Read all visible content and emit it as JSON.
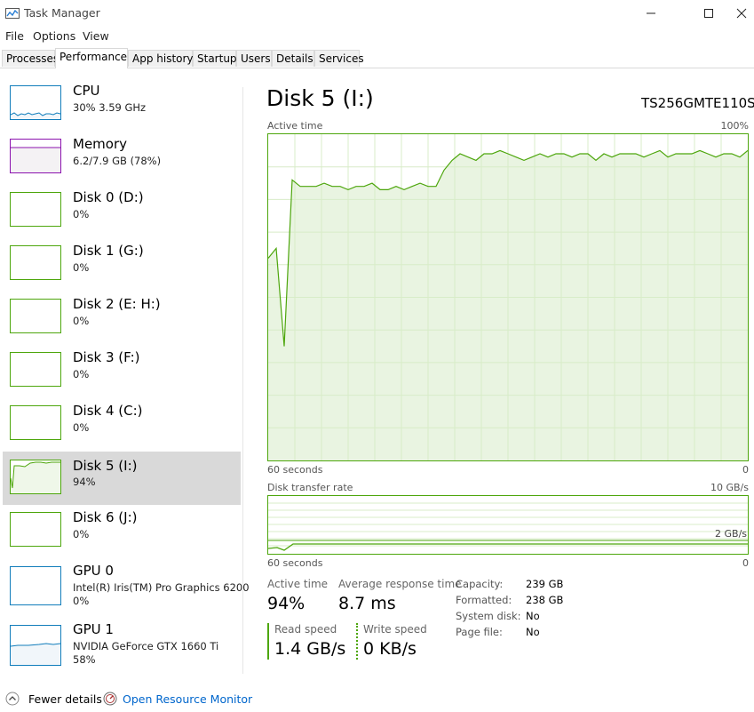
{
  "window": {
    "title": "Task Manager",
    "icon": "task-manager-icon",
    "minimize": "—",
    "maximize": "☐",
    "close": "✕"
  },
  "menu": {
    "file": "File",
    "options": "Options",
    "view": "View"
  },
  "tabs": [
    "Processes",
    "Performance",
    "App history",
    "Startup",
    "Users",
    "Details",
    "Services"
  ],
  "active_tab": "Performance",
  "sidebar": {
    "items": [
      {
        "name": "CPU",
        "line1": "30% 3.59 GHz",
        "line2": "",
        "color": "#117dbb"
      },
      {
        "name": "Memory",
        "line1": "6.2/7.9 GB (78%)",
        "line2": "",
        "color": "#8b12ae"
      },
      {
        "name": "Disk 0 (D:)",
        "line1": "0%",
        "line2": "",
        "color": "#4da60c"
      },
      {
        "name": "Disk 1 (G:)",
        "line1": "0%",
        "line2": "",
        "color": "#4da60c"
      },
      {
        "name": "Disk 2 (E: H:)",
        "line1": "0%",
        "line2": "",
        "color": "#4da60c"
      },
      {
        "name": "Disk 3 (F:)",
        "line1": "0%",
        "line2": "",
        "color": "#4da60c"
      },
      {
        "name": "Disk 4 (C:)",
        "line1": "0%",
        "line2": "",
        "color": "#4da60c"
      },
      {
        "name": "Disk 5 (I:)",
        "line1": "94%",
        "line2": "",
        "color": "#4da60c"
      },
      {
        "name": "Disk 6 (J:)",
        "line1": "0%",
        "line2": "",
        "color": "#4da60c"
      },
      {
        "name": "GPU 0",
        "line1": "Intel(R) Iris(TM) Pro Graphics 6200",
        "line2": "0%",
        "color": "#117dbb"
      },
      {
        "name": "GPU 1",
        "line1": "NVIDIA GeForce GTX 1660 Ti",
        "line2": "58%",
        "color": "#117dbb"
      }
    ],
    "selected_index": 7
  },
  "detail": {
    "title": "Disk 5 (I:)",
    "model": "TS256GMTE110S",
    "active_time_graph": {
      "label": "Active time",
      "max": "100%",
      "x_left": "60 seconds",
      "x_right": "0"
    },
    "transfer_graph": {
      "label": "Disk transfer rate",
      "max": "10 GB/s",
      "marker": "2 GB/s",
      "x_left": "60 seconds",
      "x_right": "0"
    },
    "stats": {
      "active_time_label": "Active time",
      "active_time_value": "94%",
      "avg_response_label": "Average response time",
      "avg_response_value": "8.7 ms",
      "read_speed_label": "Read speed",
      "read_speed_value": "1.4 GB/s",
      "write_speed_label": "Write speed",
      "write_speed_value": "0 KB/s"
    },
    "properties": [
      {
        "label": "Capacity:",
        "value": "239 GB"
      },
      {
        "label": "Formatted:",
        "value": "238 GB"
      },
      {
        "label": "System disk:",
        "value": "No"
      },
      {
        "label": "Page file:",
        "value": "No"
      }
    ]
  },
  "footer": {
    "fewer_details": "Fewer details",
    "open_resource_monitor": "Open Resource Monitor"
  },
  "colors": {
    "disk_green": "#4da60c",
    "cpu_blue": "#117dbb",
    "memory_purple": "#8b12ae",
    "link_blue": "#0066cc",
    "selected_bg": "#d9d9d9"
  },
  "chart_data": {
    "type": "area",
    "series": [
      {
        "values": [
          62,
          65,
          35,
          86,
          84,
          84,
          84,
          85,
          84,
          84,
          83,
          84,
          84,
          85,
          83,
          83,
          84,
          83,
          84,
          85,
          84,
          84,
          89,
          92,
          94,
          93,
          92,
          94,
          94,
          95,
          94,
          93,
          92,
          93,
          94,
          93,
          94,
          94,
          93,
          94,
          94,
          92,
          94,
          93,
          94,
          94,
          94,
          93,
          94,
          95,
          93,
          94,
          94,
          94,
          95,
          94,
          93,
          94,
          94,
          93,
          95
        ]
      }
    ],
    "xlim": [
      "60 seconds",
      "0"
    ],
    "ylim": [
      0,
      100
    ],
    "ylabel": "Active time",
    "grid": true
  }
}
